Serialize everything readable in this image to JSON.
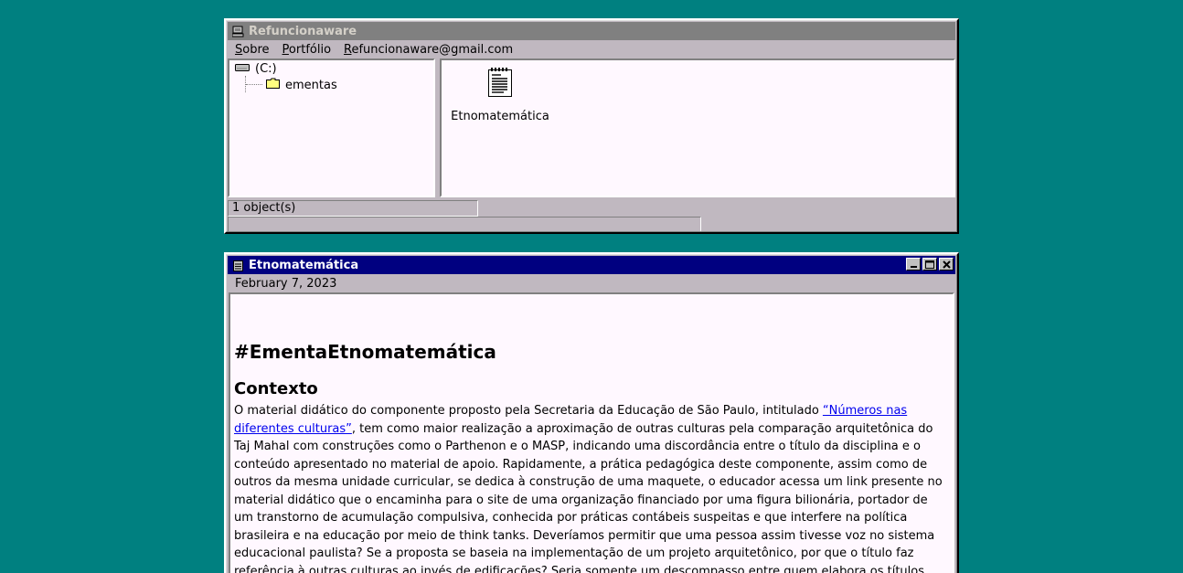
{
  "explorer": {
    "title": "Refuncionaware",
    "menu": [
      {
        "prefix": "",
        "accel": "S",
        "rest": "obre"
      },
      {
        "prefix": "",
        "accel": "P",
        "rest": "ortfólio"
      },
      {
        "prefix": "",
        "accel": "R",
        "rest": "efuncionaware@gmail.com"
      }
    ],
    "tree": {
      "drive_label": "(C:)",
      "folder_label": "ementas"
    },
    "files": [
      {
        "label": "Etnomatemática",
        "icon": "document-icon"
      }
    ],
    "status": "1 object(s)"
  },
  "document": {
    "title": "Etnomatemática",
    "date": "February 7, 2023",
    "heading": "#EmentaEtnomatemática",
    "subheading": "Contexto",
    "para_before_link": "O material didático do componente proposto pela Secretaria da Educação de São Paulo, intitulado ",
    "link_text": "“Números nas diferentes culturas”",
    "para_after_link": ", tem como maior realização a aproximação de outras culturas pela comparação arquitetônica do Taj Mahal com construções como o Parthenon e o MASP, indicando uma discordância entre o título da disciplina e o conteúdo apresentado no material de apoio. Rapidamente, a prática pedagógica deste componente, assim como de outros da mesma unidade curricular, se dedica à construção de uma maquete, o educador acessa um link presente no material didático que o encaminha para o site de uma organização financiado por uma figura bilionária, portador de um transtorno de acumulação compulsiva, conhecida por práticas contábeis suspeitas e que interfere na política brasileira e na educação por meio de think tanks. Deveríamos permitir que uma pessoa assim tivesse voz no sistema educacional paulista? Se a proposta se baseia na implementação de um projeto arquitetônico, por que o título faz referência à outras culturas ao invés de edificações? Seria somente um descompasso entre quem elabora os títulos dos Itinerários e"
  },
  "colors": {
    "desktop": "#008080",
    "active_title": "#000080",
    "inactive_title": "#808080",
    "window_face": "#c0b8c0",
    "pane_bg": "#fff8ff",
    "link": "#0000ee"
  }
}
